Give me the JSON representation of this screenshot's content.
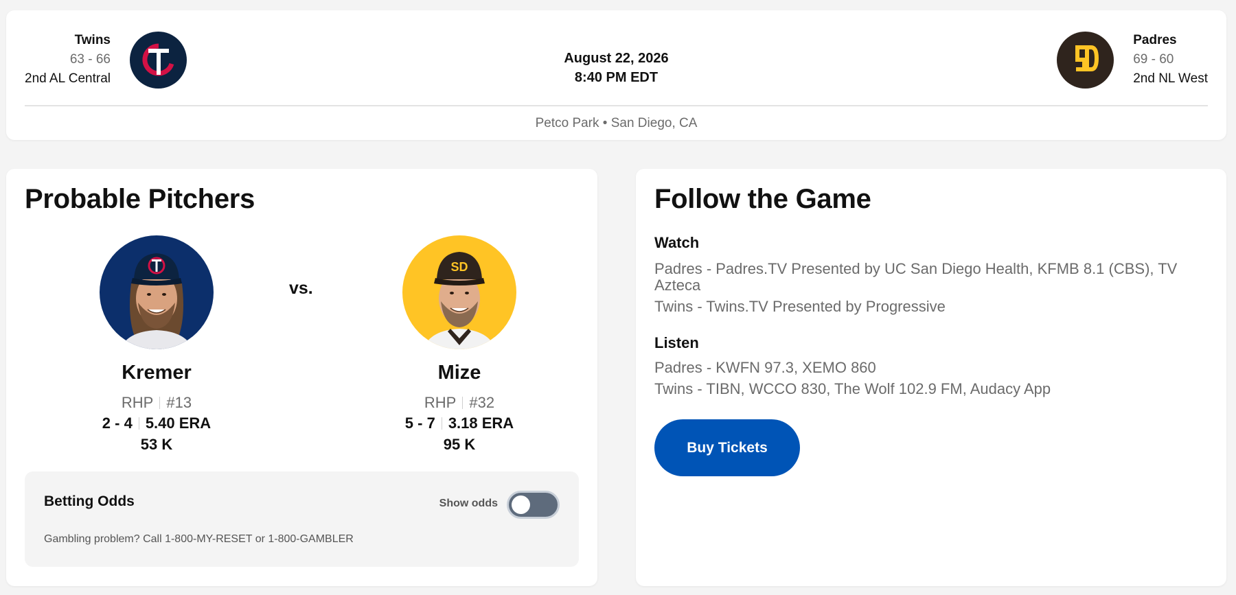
{
  "header": {
    "away_team": {
      "name": "Twins",
      "record": "63 - 66",
      "standing": "2nd AL Central",
      "logo_icon": "twins-logo-icon",
      "color": "#0c2340",
      "accent": "#d31145"
    },
    "home_team": {
      "name": "Padres",
      "record": "69 - 60",
      "standing": "2nd NL West",
      "logo_icon": "padres-logo-icon",
      "color": "#2f241d",
      "accent": "#ffc425"
    },
    "date": "August 22, 2026",
    "time": "8:40 PM EDT",
    "venue": "Petco Park • San Diego, CA"
  },
  "pitchers": {
    "title": "Probable Pitchers",
    "vs_label": "vs.",
    "away": {
      "name": "Kremer",
      "throws": "RHP",
      "number": "#13",
      "record": "2 - 4",
      "era": "5.40 ERA",
      "strikeouts": "53 K",
      "headshot_icon": "kremer-headshot"
    },
    "home": {
      "name": "Mize",
      "throws": "RHP",
      "number": "#32",
      "record": "5 - 7",
      "era": "3.18 ERA",
      "strikeouts": "95 K",
      "headshot_icon": "mize-headshot"
    },
    "betting": {
      "title": "Betting Odds",
      "toggle_label": "Show odds",
      "toggle_on": false,
      "disclaimer": "Gambling problem? Call 1-800-MY-RESET or 1-800-GAMBLER"
    }
  },
  "follow": {
    "title": "Follow the Game",
    "watch_label": "Watch",
    "watch": [
      "Padres - Padres.TV Presented by UC San Diego Health, KFMB 8.1 (CBS), TV Azteca",
      "Twins - Twins.TV Presented by Progressive"
    ],
    "listen_label": "Listen",
    "listen": [
      "Padres - KWFN 97.3, XEMO 860",
      "Twins - TIBN, WCCO 830, The Wolf 102.9 FM, Audacy App"
    ],
    "buy_tickets_label": "Buy Tickets",
    "button_color": "#0054b6"
  }
}
